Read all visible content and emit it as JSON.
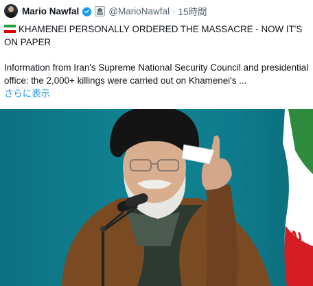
{
  "author": {
    "name": "Mario Nawfal",
    "handle": "@MarioNawfal",
    "separator": "·",
    "time": "15時間"
  },
  "post": {
    "headline": "KHAMENEI PERSONALLY ORDERED THE MASSACRE - NOW IT'S ON PAPER",
    "body": "Information from Iran's Supreme National Security Council and presidential office: the 2,000+ killings were carried out on Khamenei's ...",
    "show_more": "さらに表示"
  },
  "icons": {
    "verified": "verified-check-icon",
    "affiliate": "affiliate-badge-icon",
    "flag": "iran-flag-icon"
  },
  "colors": {
    "verified_blue": "#1d9bf0",
    "link_blue": "#1d9bf0",
    "secondary_text": "#536471",
    "photo_background": "#138796"
  }
}
